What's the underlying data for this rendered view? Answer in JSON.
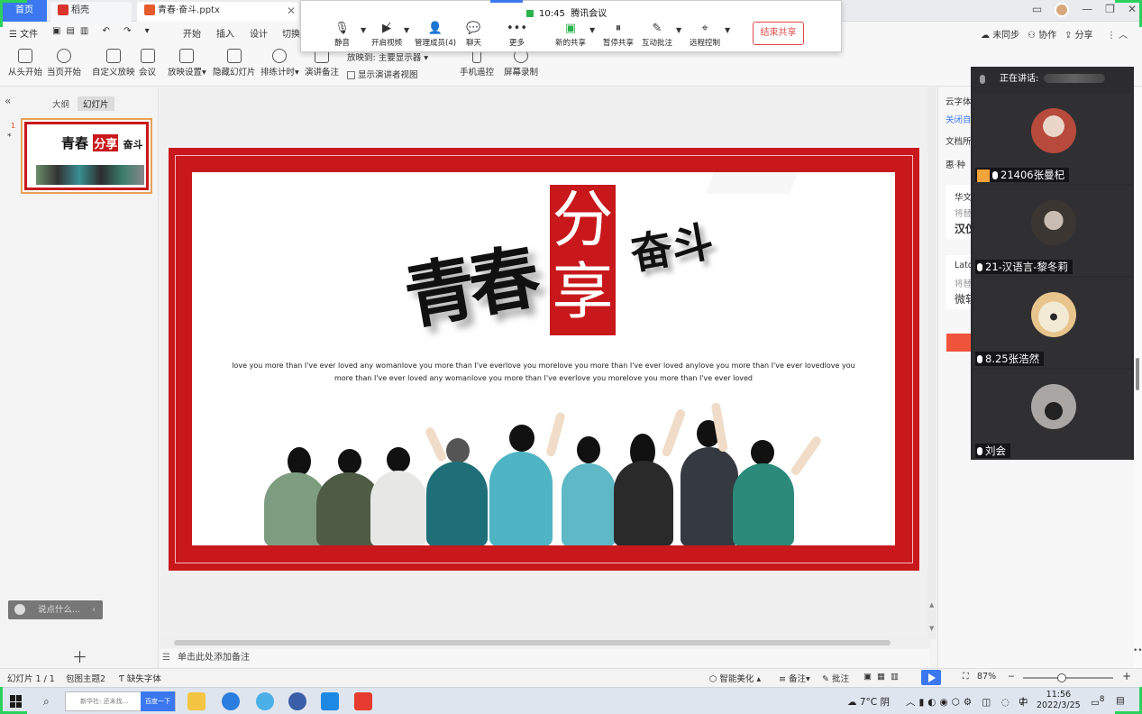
{
  "tabs": {
    "home": "首页",
    "daoke": "稻壳",
    "file": "青春·奋斗.pptx"
  },
  "menu": {
    "file": "文件",
    "items": [
      "开始",
      "插入",
      "设计",
      "切换"
    ],
    "right": [
      "未同步",
      "协作",
      "分享"
    ]
  },
  "tools": {
    "from_start": "从头开始",
    "from_current": "当页开始",
    "custom": "自定义放映",
    "meeting": "会议",
    "setup": "放映设置",
    "hide": "隐藏幻灯片",
    "rehearse": "排练计时",
    "notes": "演讲备注",
    "play_to_label": "放映到:",
    "play_to_value": "主要显示器",
    "presenter_view": "显示演讲者视图",
    "phone_remote": "手机遥控",
    "screen_record": "屏幕录制"
  },
  "meeting": {
    "time": "10:45",
    "title": "腾讯会议",
    "mute": "静音",
    "video": "开启视频",
    "members": "管理成员(4)",
    "chat": "聊天",
    "more": "更多",
    "new_share": "新的共享",
    "pause_share": "暂停共享",
    "annotate": "互动批注",
    "remote": "远程控制",
    "end_share": "结束共享"
  },
  "left": {
    "outline": "大纲",
    "slides": "幻灯片",
    "slide_num": "1",
    "star": "*",
    "say": "说点什么...",
    "thumb_title": "青春",
    "thumb_box": "分享",
    "thumb_sub": "奋斗"
  },
  "slide": {
    "title": "青春",
    "box_line1": "分",
    "box_line2": "享",
    "subtitle": "奋斗",
    "body": "love you more than I've ever loved any womanlove you more than I've everlove you morelove you more than I've ever loved anylove you more than I've ever lovedlove you more than I've ever loved any womanlove you more than I've everlove you morelove you more than I've ever loved"
  },
  "notes_placeholder": "单击此处添加备注",
  "right_panel": {
    "cloud_font": "云字体",
    "close": "关闭自",
    "doc": "文档所",
    "font1": "华文",
    "font1_sample": "汉仪",
    "replace": "将替",
    "font2": "Lato",
    "font2_sample": "微软",
    "fang": "惠·种"
  },
  "video": {
    "speaking": "正在讲话:",
    "participants": [
      {
        "name": "21406张曼杞",
        "color": "#b84a3c"
      },
      {
        "name": "21-汉语言-黎冬莉",
        "color": "#3c3632"
      },
      {
        "name": "8.25张浩然",
        "color": "#e8c58c"
      },
      {
        "name": "刘会",
        "color": "#a9a6a4"
      }
    ]
  },
  "status": {
    "slide": "幻灯片 1 / 1",
    "theme": "包图主题2",
    "missing_font": "缺失字体",
    "beautify": "智能美化",
    "notes": "备注",
    "comment": "批注",
    "zoom": "87%"
  },
  "taskbar": {
    "search_placeholder": "新华社: 还未找...",
    "baidu": "百度一下",
    "weather": "7°C 阴",
    "ime": "中",
    "time": "11:56",
    "date": "2022/3/25",
    "notif": "8"
  }
}
